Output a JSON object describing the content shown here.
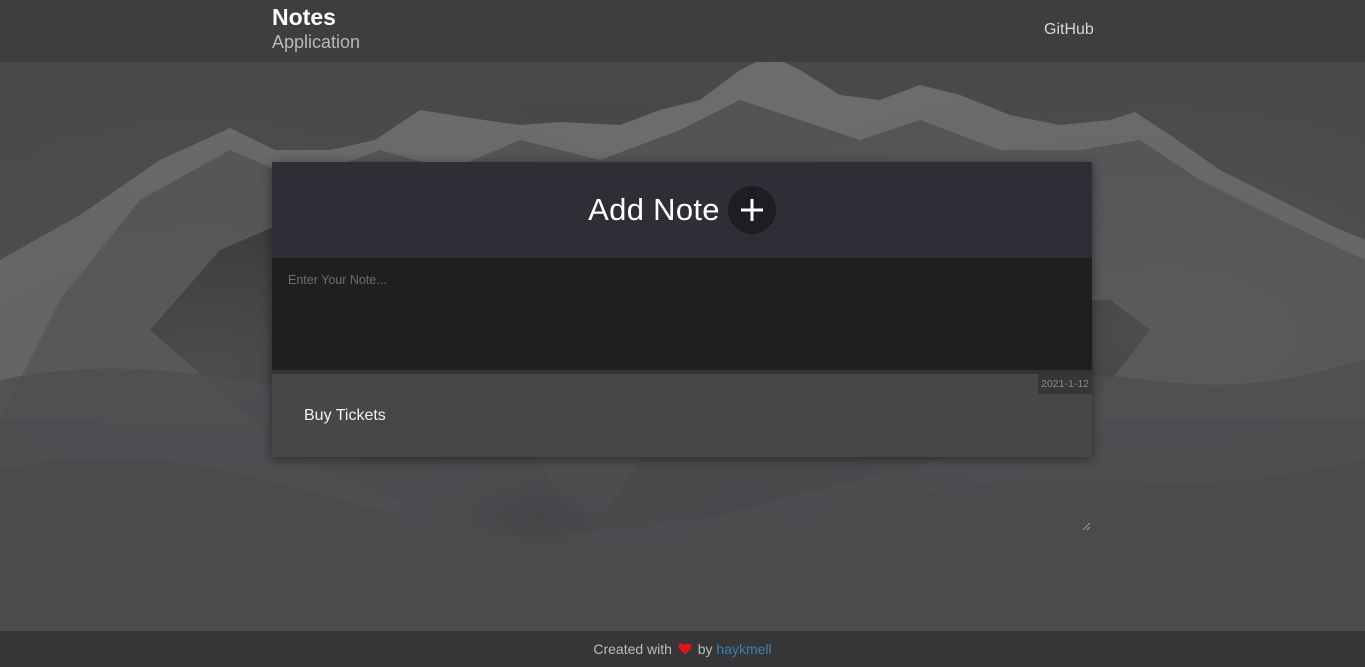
{
  "header": {
    "title": "Notes",
    "subtitle": "Application",
    "github_link": "GitHub"
  },
  "composer": {
    "title": "Add Note",
    "add_icon": "plus-icon",
    "placeholder": "Enter Your Note..."
  },
  "notes": [
    {
      "text": "Buy Tickets",
      "date": "2021-1-12"
    }
  ],
  "footer": {
    "prefix": "Created with",
    "heart_icon": "heart-icon",
    "by": "by",
    "author": "haykmell"
  },
  "colors": {
    "accent_link": "#3d7fb3",
    "heart": "#e3131a"
  }
}
